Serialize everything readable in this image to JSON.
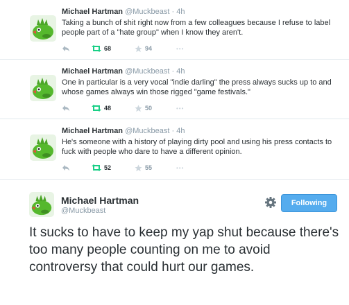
{
  "timeline": {
    "tweets": [
      {
        "name": "Michael Hartman",
        "handle": "@Muckbeast",
        "separator": "·",
        "time": "4h",
        "text": "Taking a bunch of shit right now from a few colleagues because I refuse to label people part of a \"hate group\" when I know they aren't.",
        "retweets": "68",
        "favorites": "94",
        "more": "•••"
      },
      {
        "name": "Michael Hartman",
        "handle": "@Muckbeast",
        "separator": "·",
        "time": "4h",
        "text": "One in particular is a very vocal \"indie darling\" the press always sucks up to and whose games always win those rigged \"game festivals.\"",
        "retweets": "48",
        "favorites": "50",
        "more": "•••"
      },
      {
        "name": "Michael Hartman",
        "handle": "@Muckbeast",
        "separator": "·",
        "time": "4h",
        "text": "He's someone with a history of playing dirty pool and using his press contacts to fuck with people who dare to have a different opinion.",
        "retweets": "52",
        "favorites": "55",
        "more": "•••"
      }
    ]
  },
  "main_tweet": {
    "name": "Michael Hartman",
    "handle": "@Muckbeast",
    "follow_label": "Following",
    "text": "It sucks to have to keep my yap shut because there's too many people counting on me to avoid controversy that could hurt our games."
  },
  "icons": {
    "reply": "reply-icon",
    "retweet": "retweet-icon",
    "favorite": "star-icon",
    "more": "more-icon",
    "settings": "gear-icon"
  },
  "colors": {
    "retweet_active": "#19cf86",
    "follow_button": "#55acee",
    "muted": "#8899a6"
  }
}
